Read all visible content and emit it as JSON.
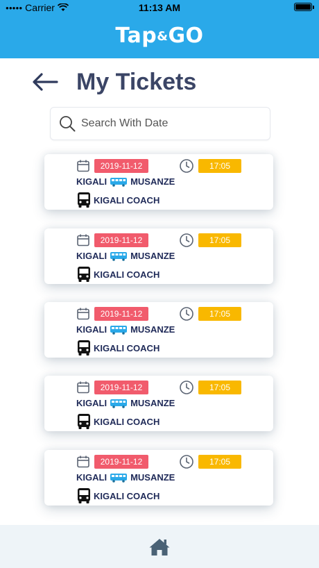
{
  "status_bar": {
    "carrier": "Carrier",
    "time": "11:13 AM"
  },
  "header": {
    "app_title_left": "Tap",
    "app_title_amp": "&",
    "app_title_right": "GO"
  },
  "page": {
    "title": "My Tickets"
  },
  "search": {
    "placeholder": "Search With Date"
  },
  "tickets": [
    {
      "date": "2019-11-12",
      "time": "17:05",
      "from": "KIGALI",
      "to": "MUSANZE",
      "company": "KIGALI COACH"
    },
    {
      "date": "2019-11-12",
      "time": "17:05",
      "from": "KIGALI",
      "to": "MUSANZE",
      "company": "KIGALI COACH"
    },
    {
      "date": "2019-11-12",
      "time": "17:05",
      "from": "KIGALI",
      "to": "MUSANZE",
      "company": "KIGALI COACH"
    },
    {
      "date": "2019-11-12",
      "time": "17:05",
      "from": "KIGALI",
      "to": "MUSANZE",
      "company": "KIGALI COACH"
    },
    {
      "date": "2019-11-12",
      "time": "17:05",
      "from": "KIGALI",
      "to": "MUSANZE",
      "company": "KIGALI COACH"
    }
  ],
  "colors": {
    "header": "#2aa9e9",
    "date_badge": "#f15b6c",
    "time_badge": "#f9b800",
    "tabbar": "#eef4f8"
  },
  "icons": {
    "back": "arrow-left-icon",
    "search": "search-icon",
    "calendar": "calendar-icon",
    "clock": "clock-icon",
    "bus_side": "bus-side-icon",
    "bus_front": "bus-front-icon",
    "home": "home-icon"
  }
}
